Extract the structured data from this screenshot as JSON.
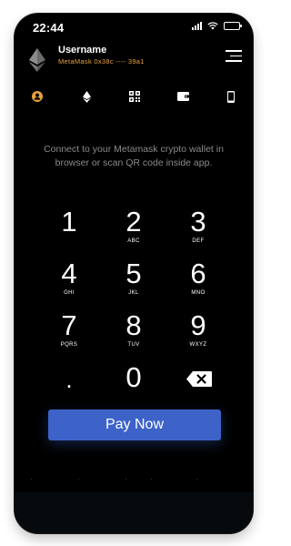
{
  "status_bar": {
    "time": "22:44"
  },
  "header": {
    "username": "Username",
    "address": "MetaMask 0x38c ---- 39a1",
    "logo_icon": "ethereum-logo",
    "menu_icon": "hamburger-menu-icon"
  },
  "tabs": [
    {
      "icon": "user-icon",
      "active": true
    },
    {
      "icon": "ethereum-icon",
      "active": false
    },
    {
      "icon": "qr-code-icon",
      "active": false
    },
    {
      "icon": "wallet-icon",
      "active": false
    },
    {
      "icon": "mobile-phone-icon",
      "active": false
    }
  ],
  "instruction": "Connect to your Metamask crypto wallet in browser or scan QR code inside app.",
  "keypad": [
    {
      "digit": "1",
      "letters": ""
    },
    {
      "digit": "2",
      "letters": "ABC"
    },
    {
      "digit": "3",
      "letters": "DEF"
    },
    {
      "digit": "4",
      "letters": "GHI"
    },
    {
      "digit": "5",
      "letters": "JKL"
    },
    {
      "digit": "6",
      "letters": "MNO"
    },
    {
      "digit": "7",
      "letters": "PQRS"
    },
    {
      "digit": "8",
      "letters": "TUV"
    },
    {
      "digit": "9",
      "letters": "WXYZ"
    },
    {
      "digit": ".",
      "letters": ""
    },
    {
      "digit": "0",
      "letters": ""
    }
  ],
  "backspace_icon": "backspace-icon",
  "pay_button": {
    "label": "Pay Now"
  },
  "colors": {
    "background": "#000000",
    "accent": "#e6a23c",
    "button": "#3d63c9",
    "instruction_text": "#8a8a8a"
  }
}
